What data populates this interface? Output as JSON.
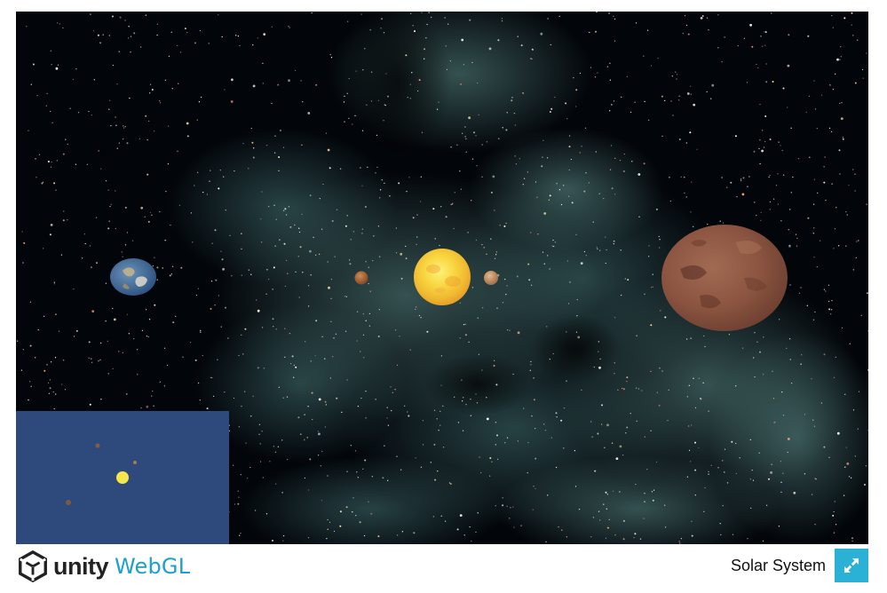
{
  "app": {
    "logo_text": "unity",
    "platform_text": "WebGL",
    "build_title": "Solar System"
  },
  "scene": {
    "background_color": "#02050a",
    "nebula_color": "#5f8f8a",
    "bodies": [
      {
        "name": "Sun",
        "color": "#f6dc3c"
      },
      {
        "name": "Earth",
        "color": "#3d6aa0"
      },
      {
        "name": "Mars",
        "color": "#8c5a45"
      },
      {
        "name": "small-planet-left",
        "color": "#a8663a"
      },
      {
        "name": "small-planet-right",
        "color": "#c49266"
      }
    ]
  },
  "minimap": {
    "background_color": "#2e4a7c"
  },
  "colors": {
    "accent": "#2bb0d6",
    "webgl_text": "#1ba1cb"
  },
  "icons": {
    "logo": "unity-logo-icon",
    "fullscreen": "fullscreen-expand-icon"
  }
}
